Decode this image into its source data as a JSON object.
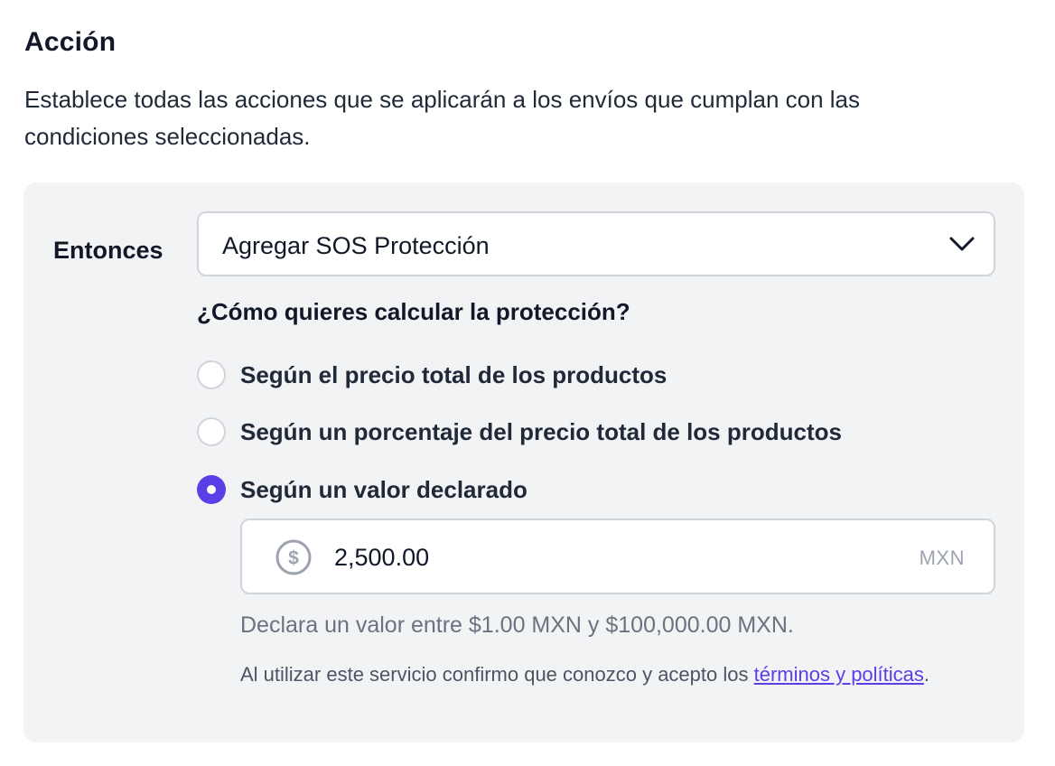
{
  "section": {
    "title": "Acción",
    "description": "Establece todas las acciones que se aplicarán a los envíos que cumplan con las condiciones seleccionadas."
  },
  "action": {
    "label": "Entonces",
    "select_value": "Agregar SOS Protección"
  },
  "protection": {
    "question": "¿Cómo quieres calcular la protección?",
    "options": [
      {
        "label": "Según el precio total de los productos",
        "checked": false
      },
      {
        "label": "Según un porcentaje del precio total de los productos",
        "checked": false
      },
      {
        "label": "Según un valor declarado",
        "checked": true
      }
    ]
  },
  "amount": {
    "value": "2,500.00",
    "currency": "MXN",
    "hint": "Declara un valor entre $1.00 MXN y $100,000.00 MXN."
  },
  "terms": {
    "text_before": "Al utilizar este servicio confirmo que conozco y acepto los ",
    "link_text": "términos y políticas",
    "text_after": "."
  },
  "colors": {
    "accent": "#5b3fe6",
    "panel_bg": "#f2f3f5",
    "border": "#d1d5db",
    "muted_text": "#6b7280"
  }
}
